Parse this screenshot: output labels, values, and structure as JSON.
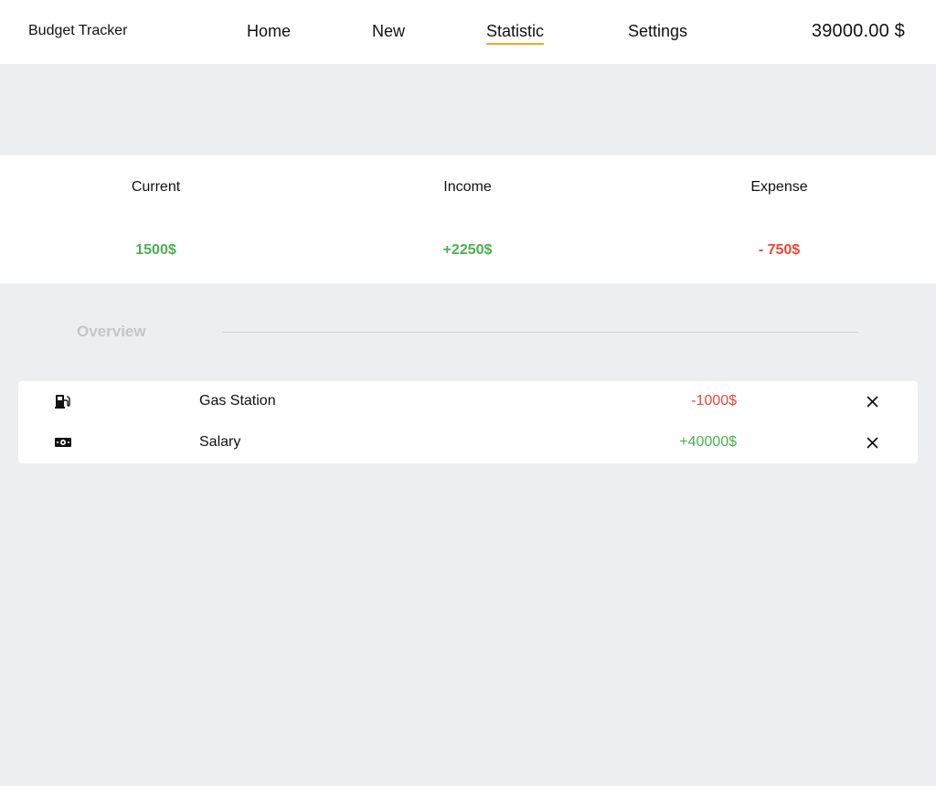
{
  "header": {
    "brand": "Budget Tracker",
    "nav": [
      {
        "label": "Home"
      },
      {
        "label": "New"
      },
      {
        "label": "Statistic",
        "active": true
      },
      {
        "label": "Settings"
      }
    ],
    "balance": "39000.00 $"
  },
  "summary": {
    "current": {
      "label": "Current",
      "value": "1500$"
    },
    "income": {
      "label": "Income",
      "value": "+2250$"
    },
    "expense": {
      "label": "Expense",
      "value": "- 750$"
    }
  },
  "overview": {
    "title": "Overview"
  },
  "transactions": [
    {
      "icon": "gas-pump-icon",
      "name": "Gas Station",
      "amount": "-1000$",
      "type": "expense"
    },
    {
      "icon": "money-bill-icon",
      "name": "Salary",
      "amount": "+40000$",
      "type": "income"
    }
  ],
  "colors": {
    "positive": "#4caf50",
    "negative": "#f04438",
    "accent": "#f5a623",
    "background": "#edeef2"
  }
}
